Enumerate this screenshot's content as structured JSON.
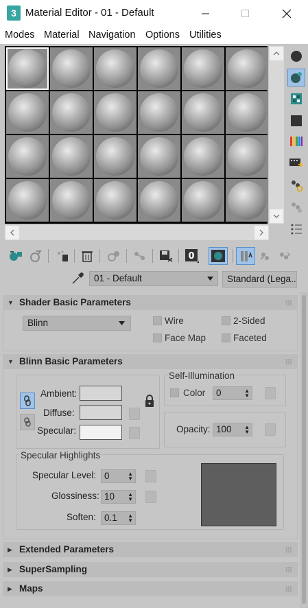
{
  "window": {
    "title": "Material Editor - 01 - Default",
    "app_icon": "3",
    "minimize_icon": "minimize-icon",
    "maximize_icon": "maximize-icon",
    "close_icon": "close-icon"
  },
  "menu": [
    "Modes",
    "Material",
    "Navigation",
    "Options",
    "Utilities"
  ],
  "sample_slots": {
    "rows": 4,
    "columns": 6,
    "active_index": 0
  },
  "material": {
    "name": "01 - Default",
    "type": "Standard (Lega..."
  },
  "shader_rollout": {
    "title": "Shader Basic Parameters",
    "shader": "Blinn",
    "wire": "Wire",
    "two_sided": "2-Sided",
    "face_map": "Face Map",
    "faceted": "Faceted"
  },
  "blinn_rollout": {
    "title": "Blinn Basic Parameters",
    "ambient_label": "Ambient:",
    "diffuse_label": "Diffuse:",
    "specular_label": "Specular:",
    "ambient_color": "#d6d6d6",
    "diffuse_color": "#d6d6d6",
    "specular_color": "#f2f2f2",
    "self_illum_title": "Self-Illumination",
    "color_label": "Color",
    "self_illum_value": "0",
    "opacity_label": "Opacity:",
    "opacity_value": "100",
    "spec_highlights_title": "Specular Highlights",
    "spec_level_label": "Specular Level:",
    "spec_level_value": "0",
    "glossiness_label": "Glossiness:",
    "glossiness_value": "10",
    "soften_label": "Soften:",
    "soften_value": "0.1",
    "highlight_curve_color": "#5e5e5e"
  },
  "collapsed_rollouts": [
    "Extended Parameters",
    "SuperSampling",
    "Maps"
  ]
}
